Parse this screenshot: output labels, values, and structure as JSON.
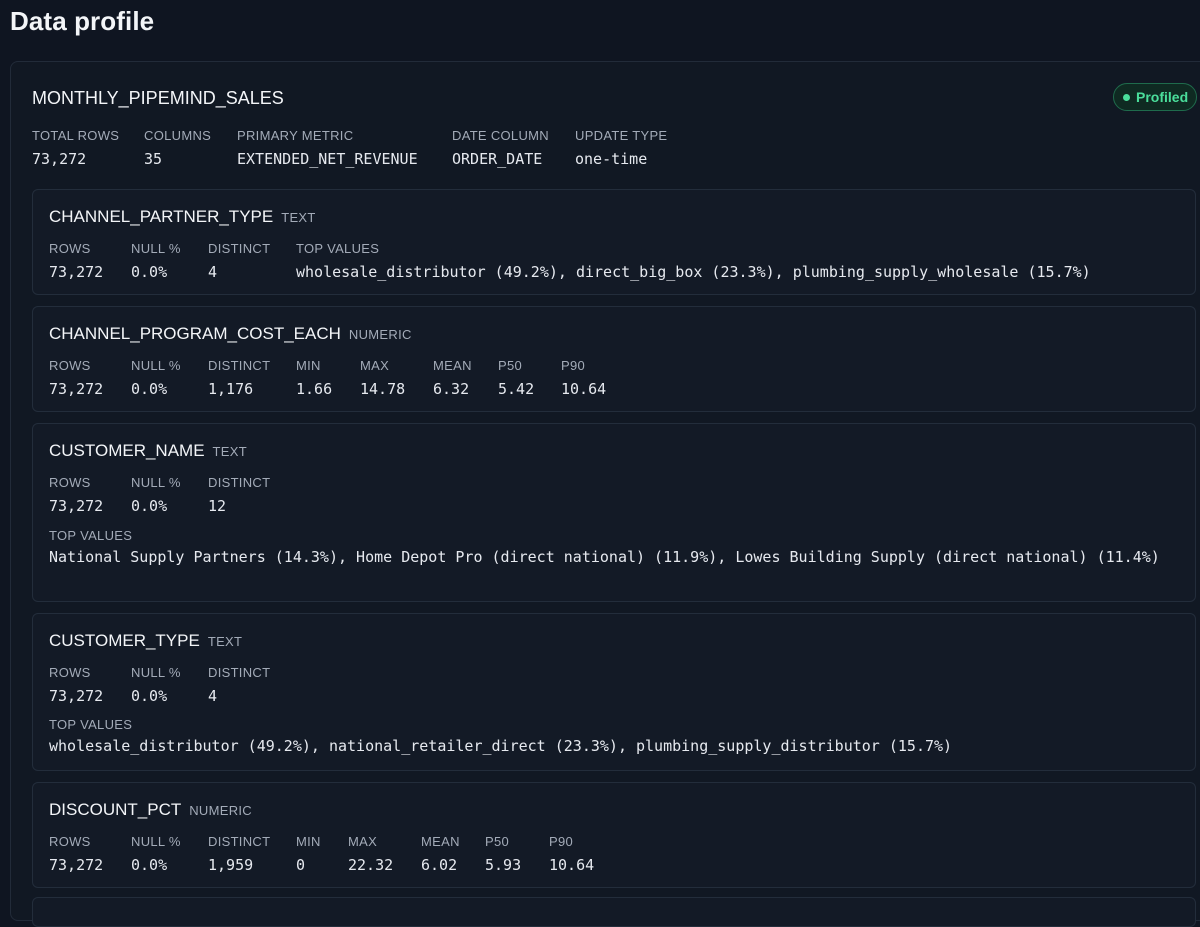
{
  "page": {
    "title": "Data profile"
  },
  "dataset": {
    "name": "MONTHLY_PIPEMIND_SALES",
    "status": "Profiled",
    "stats": [
      {
        "label": "TOTAL ROWS",
        "value": "73,272"
      },
      {
        "label": "COLUMNS",
        "value": "35"
      },
      {
        "label": "PRIMARY METRIC",
        "value": "EXTENDED_NET_REVENUE"
      },
      {
        "label": "DATE COLUMN",
        "value": "ORDER_DATE"
      },
      {
        "label": "UPDATE TYPE",
        "value": "one-time"
      }
    ]
  },
  "columns": [
    {
      "name": "CHANNEL_PARTNER_TYPE",
      "type": "TEXT",
      "stats": [
        {
          "label": "ROWS",
          "value": "73,272"
        },
        {
          "label": "NULL %",
          "value": "0.0%"
        },
        {
          "label": "DISTINCT",
          "value": "4"
        },
        {
          "label": "TOP VALUES",
          "value": "wholesale_distributor (49.2%), direct_big_box (23.3%), plumbing_supply_wholesale (15.7%)"
        }
      ]
    },
    {
      "name": "CHANNEL_PROGRAM_COST_EACH",
      "type": "NUMERIC",
      "stats": [
        {
          "label": "ROWS",
          "value": "73,272"
        },
        {
          "label": "NULL %",
          "value": "0.0%"
        },
        {
          "label": "DISTINCT",
          "value": "1,176"
        },
        {
          "label": "MIN",
          "value": "1.66"
        },
        {
          "label": "MAX",
          "value": "14.78"
        },
        {
          "label": "MEAN",
          "value": "6.32"
        },
        {
          "label": "P50",
          "value": "5.42"
        },
        {
          "label": "P90",
          "value": "10.64"
        }
      ]
    },
    {
      "name": "CUSTOMER_NAME",
      "type": "TEXT",
      "stats": [
        {
          "label": "ROWS",
          "value": "73,272"
        },
        {
          "label": "NULL %",
          "value": "0.0%"
        },
        {
          "label": "DISTINCT",
          "value": "12"
        }
      ],
      "top_values_label": "TOP VALUES",
      "top_values": "National Supply Partners (14.3%), Home Depot Pro (direct national) (11.9%), Lowes Building Supply (direct national) (11.4%)"
    },
    {
      "name": "CUSTOMER_TYPE",
      "type": "TEXT",
      "stats": [
        {
          "label": "ROWS",
          "value": "73,272"
        },
        {
          "label": "NULL %",
          "value": "0.0%"
        },
        {
          "label": "DISTINCT",
          "value": "4"
        }
      ],
      "top_values_label": "TOP VALUES",
      "top_values": "wholesale_distributor (49.2%), national_retailer_direct (23.3%), plumbing_supply_distributor (15.7%)"
    },
    {
      "name": "DISCOUNT_PCT",
      "type": "NUMERIC",
      "stats": [
        {
          "label": "ROWS",
          "value": "73,272"
        },
        {
          "label": "NULL %",
          "value": "0.0%"
        },
        {
          "label": "DISTINCT",
          "value": "1,959"
        },
        {
          "label": "MIN",
          "value": "0"
        },
        {
          "label": "MAX",
          "value": "22.32"
        },
        {
          "label": "MEAN",
          "value": "6.02"
        },
        {
          "label": "P50",
          "value": "5.93"
        },
        {
          "label": "P90",
          "value": "10.64"
        }
      ]
    }
  ],
  "colors": {
    "background": "#0f1521",
    "card": "#131a26",
    "border": "#232d3b",
    "label": "#a3abb8",
    "text": "#e6e9ef",
    "status_green": "#4ade9b"
  }
}
